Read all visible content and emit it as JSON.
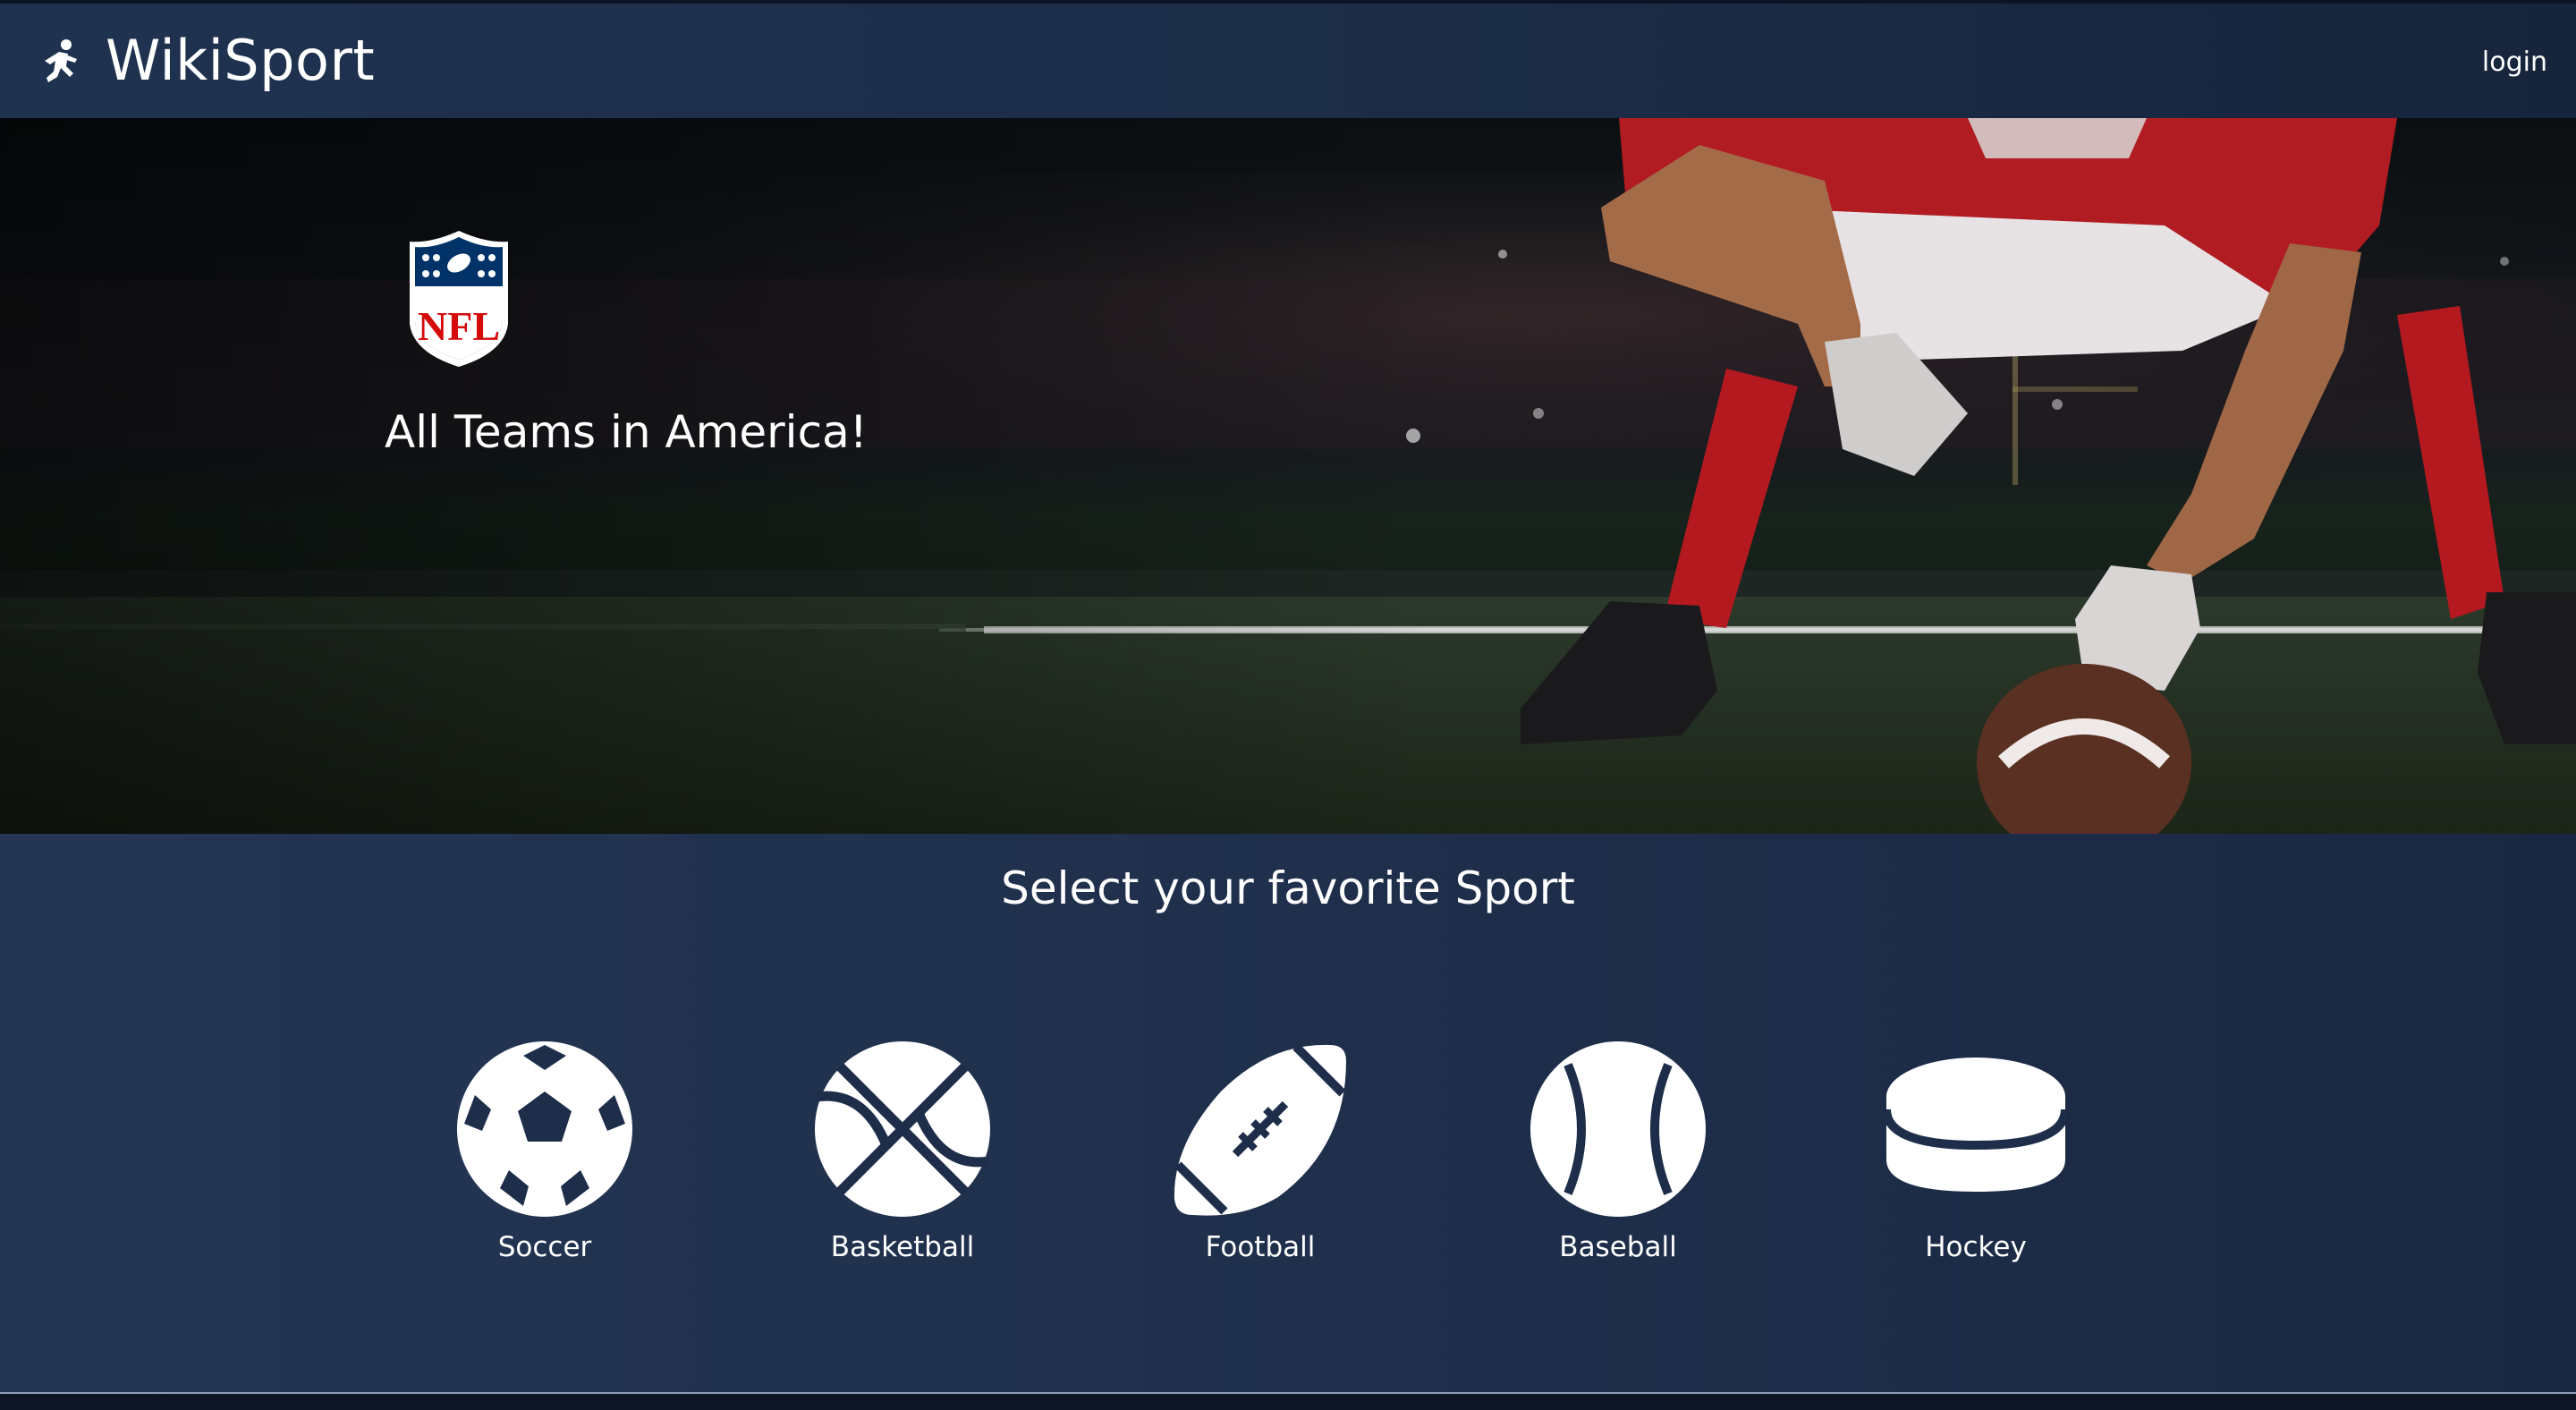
{
  "app": {
    "name": "WikiSport",
    "brand_icon": "running-person-icon"
  },
  "header": {
    "login_label": "login"
  },
  "hero": {
    "logo_text": "NFL",
    "tagline": "All Teams in America!"
  },
  "sports_section": {
    "title": "Select your favorite Sport",
    "items": [
      {
        "label": "Soccer",
        "icon": "soccer-ball-icon"
      },
      {
        "label": "Basketball",
        "icon": "basketball-icon"
      },
      {
        "label": "Football",
        "icon": "football-icon"
      },
      {
        "label": "Baseball",
        "icon": "baseball-icon"
      },
      {
        "label": "Hockey",
        "icon": "hockey-puck-icon"
      }
    ]
  },
  "colors": {
    "navbar": "#1f3250",
    "sports_bg": "#1e2e4a",
    "jersey_red": "#b81d24",
    "nfl_blue": "#013369",
    "nfl_red": "#d50a0a"
  }
}
